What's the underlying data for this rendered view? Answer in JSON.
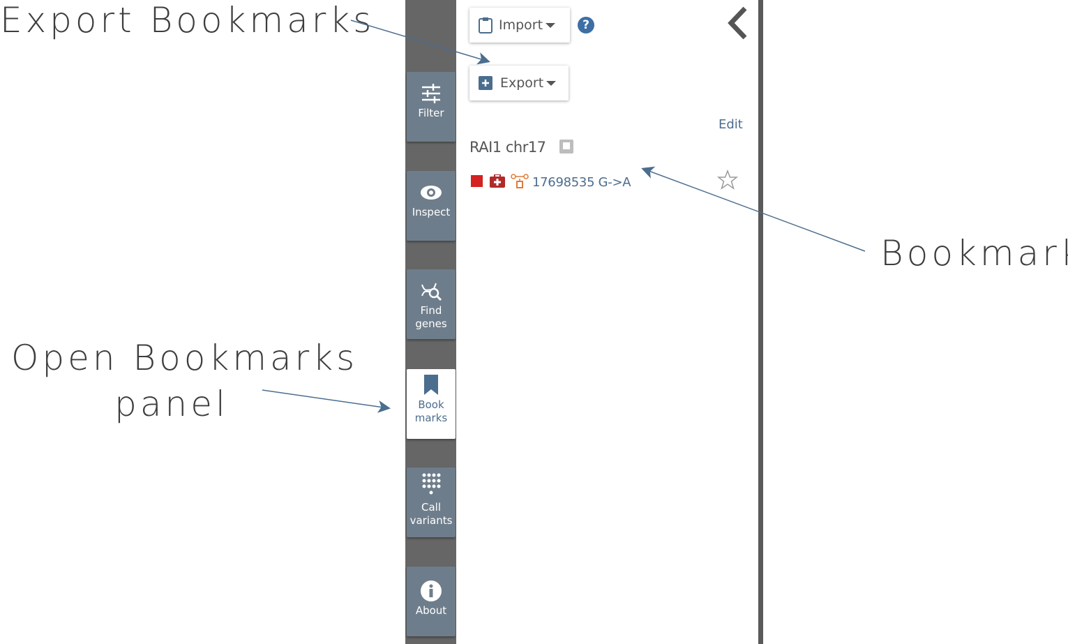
{
  "annotations": {
    "export": "Export Bookmarks",
    "bookmark": "Bookmark",
    "open_line1": "Open Bookmarks",
    "open_line2": "panel"
  },
  "nav": {
    "filter": "Filter",
    "inspect": "Inspect",
    "find_line1": "Find",
    "find_line2": "genes",
    "bookmarks_line1": "Book",
    "bookmarks_line2": "marks",
    "call_line1": "Call",
    "call_line2": "variants",
    "about": "About"
  },
  "panel": {
    "import_label": "Import",
    "export_label": "Export",
    "help": "?",
    "edit_label": "Edit",
    "gene_title": "RAI1 chr17",
    "bookmark_variant": "17698535 G->A"
  },
  "colors": {
    "accent": "#4b6d8e",
    "nav_bg": "#666666",
    "nav_button": "#6e7d8b",
    "pathogenic": "#d42121"
  }
}
